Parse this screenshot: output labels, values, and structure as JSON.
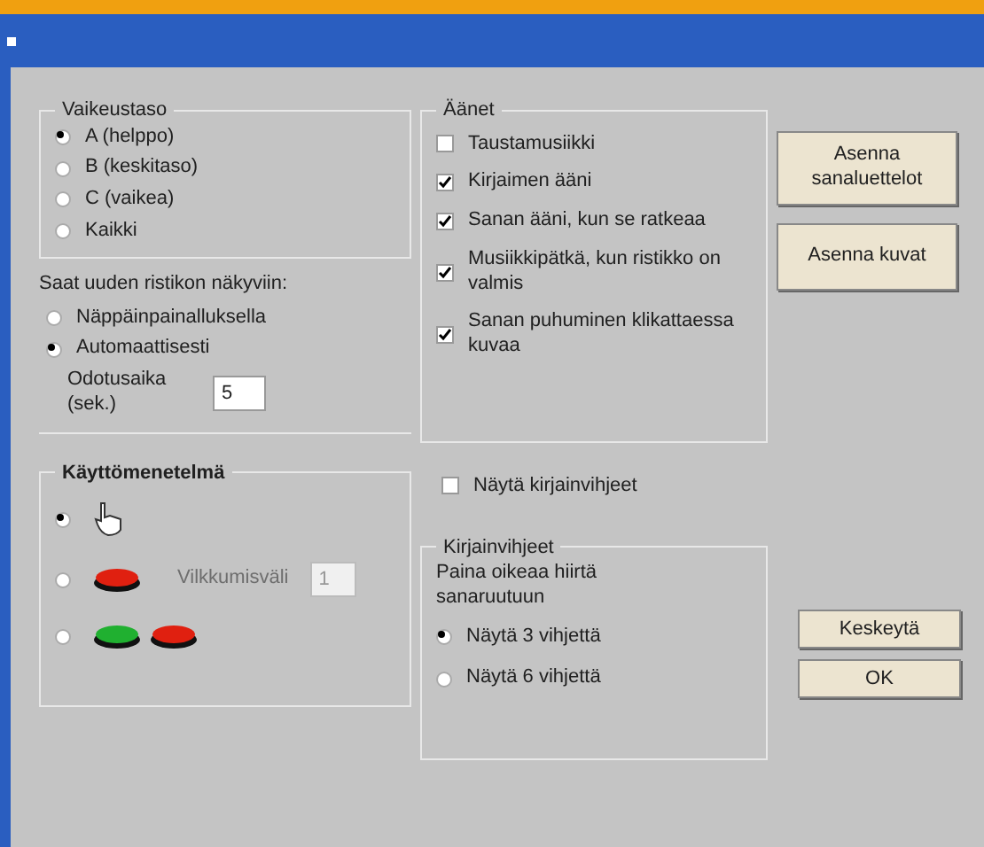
{
  "difficulty": {
    "title": "Vaikeustaso",
    "options": [
      {
        "label": "A (helppo)",
        "selected": true
      },
      {
        "label": "B (keskitaso)",
        "selected": false
      },
      {
        "label": "C (vaikea)",
        "selected": false
      },
      {
        "label": "Kaikki",
        "selected": false
      }
    ]
  },
  "next_puzzle": {
    "title": "Saat uuden ristikon näkyviin:",
    "options": [
      {
        "label": "Näppäinpainalluksella",
        "selected": false
      },
      {
        "label": "Automaattisesti",
        "selected": true
      }
    ],
    "delay_label": "Odotusaika (sek.)",
    "delay_value": "5"
  },
  "input_method": {
    "title": "Käyttömenetelmä",
    "options": [
      {
        "kind": "hand",
        "selected": true
      },
      {
        "kind": "one-button",
        "selected": false,
        "label": "Vilkkumisväli",
        "value": "1",
        "disabled": true
      },
      {
        "kind": "two-buttons",
        "selected": false
      }
    ]
  },
  "sounds": {
    "title": "Äänet",
    "items": [
      {
        "label": "Taustamusiikki",
        "checked": false
      },
      {
        "label": "Kirjaimen ääni",
        "checked": true
      },
      {
        "label": "Sanan ääni, kun se ratkeaa",
        "checked": true
      },
      {
        "label": "Musiikkipätkä, kun ristikko on valmis",
        "checked": true
      },
      {
        "label": "Sanan puhuminen klikattaessa kuvaa",
        "checked": true
      }
    ]
  },
  "show_hints": {
    "label": "Näytä kirjainvihjeet",
    "checked": false
  },
  "hints": {
    "title": "Kirjainvihjeet",
    "text": "Paina oikeaa hiirtä sanaruutuun",
    "options": [
      {
        "label": "Näytä 3 vihjettä",
        "selected": true
      },
      {
        "label": "Näytä 6 vihjettä",
        "selected": false
      }
    ]
  },
  "buttons": [
    {
      "label": "Asenna sanaluettelot"
    },
    {
      "label": "Asenna kuvat"
    }
  ],
  "dialog_buttons": [
    {
      "label": "Keskeytä"
    },
    {
      "label": "OK"
    }
  ]
}
